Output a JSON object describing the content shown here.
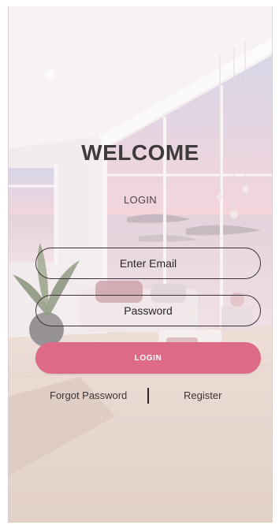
{
  "screen": {
    "title": "WELCOME",
    "subtitle": "LOGIN"
  },
  "form": {
    "email_placeholder": "Enter Email",
    "password_placeholder": "Password",
    "login_label": "LOGIN"
  },
  "links": {
    "forgot_label": "Forgot Password",
    "register_label": "Register"
  },
  "background": {
    "image_subject": "living-room-with-sea-view",
    "accent_color": "#dd6a86"
  }
}
